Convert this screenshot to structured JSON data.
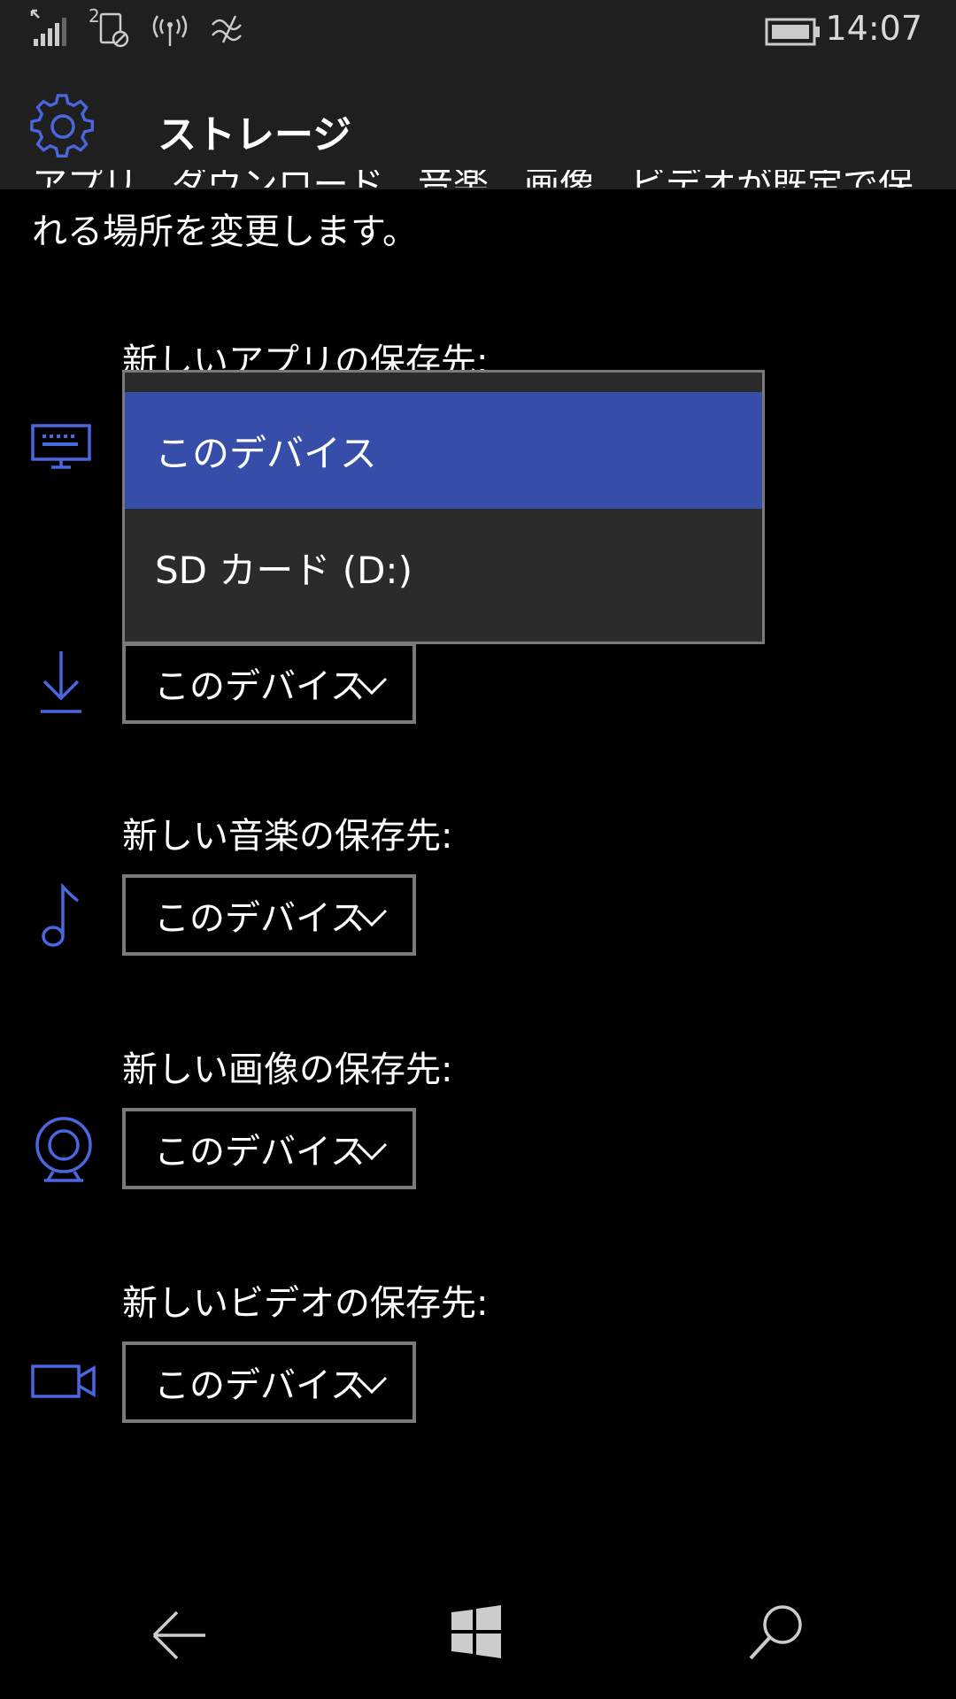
{
  "status_bar": {
    "time": "14:07",
    "icons": [
      "signal-icon",
      "sim2-icon",
      "cellular-data-icon",
      "vibrate-icon",
      "battery-icon"
    ],
    "sim_label": "2"
  },
  "header": {
    "icon": "gear-icon",
    "title": "ストレージ"
  },
  "intro": {
    "line1": "アプリ、ダウンロード、音楽、画像、ビデオが既定で保存さ",
    "line2": "れる場所を変更します。"
  },
  "sections": [
    {
      "icon": "app-display-icon",
      "label": "新しいアプリの保存先:",
      "value": "このデバイス"
    },
    {
      "icon": "download-icon",
      "label": "",
      "value": "このデバイス"
    },
    {
      "icon": "music-note-icon",
      "label": "新しい音楽の保存先:",
      "value": "このデバイス"
    },
    {
      "icon": "webcam-icon",
      "label": "新しい画像の保存先:",
      "value": "このデバイス"
    },
    {
      "icon": "video-camera-icon",
      "label": "新しいビデオの保存先:",
      "value": "このデバイス"
    }
  ],
  "popup": {
    "options": [
      "このデバイス",
      "SD カード (D:)"
    ],
    "selected": "このデバイス"
  },
  "nav": {
    "icons": [
      "back-arrow-icon",
      "windows-start-icon",
      "search-icon"
    ]
  },
  "colors": {
    "accent": "#3f5fd6",
    "selected_bg": "#364ea9",
    "header_bg": "#1f1f1f",
    "border": "#7a7a7a"
  }
}
